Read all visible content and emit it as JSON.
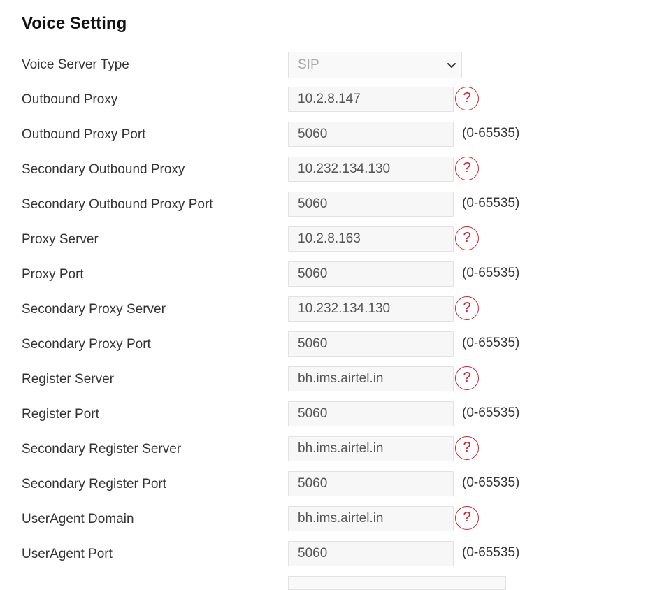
{
  "page": {
    "title": "Voice Setting"
  },
  "voice_server_type": {
    "label": "Voice Server Type",
    "value": "SIP"
  },
  "fields": [
    {
      "label": "Outbound Proxy",
      "value": "10.2.8.147",
      "suffix": "help"
    },
    {
      "label": "Outbound Proxy Port",
      "value": "5060",
      "suffix": "range",
      "range": "(0-65535)"
    },
    {
      "label": "Secondary Outbound Proxy",
      "value": "10.232.134.130",
      "suffix": "help"
    },
    {
      "label": "Secondary Outbound Proxy Port",
      "value": "5060",
      "suffix": "range",
      "range": "(0-65535)"
    },
    {
      "label": "Proxy Server",
      "value": "10.2.8.163",
      "suffix": "help"
    },
    {
      "label": "Proxy Port",
      "value": "5060",
      "suffix": "range",
      "range": "(0-65535)"
    },
    {
      "label": "Secondary Proxy Server",
      "value": "10.232.134.130",
      "suffix": "help"
    },
    {
      "label": "Secondary Proxy Port",
      "value": "5060",
      "suffix": "range",
      "range": "(0-65535)"
    },
    {
      "label": "Register Server",
      "value": "bh.ims.airtel.in",
      "suffix": "help"
    },
    {
      "label": "Register Port",
      "value": "5060",
      "suffix": "range",
      "range": "(0-65535)"
    },
    {
      "label": "Secondary Register Server",
      "value": "bh.ims.airtel.in",
      "suffix": "help"
    },
    {
      "label": "Secondary Register Port",
      "value": "5060",
      "suffix": "range",
      "range": "(0-65535)"
    },
    {
      "label": "UserAgent Domain",
      "value": "bh.ims.airtel.in",
      "suffix": "help"
    },
    {
      "label": "UserAgent Port",
      "value": "5060",
      "suffix": "range",
      "range": "(0-65535)"
    }
  ],
  "help_symbol": "?",
  "colors": {
    "accent": "#d5232d",
    "field_background": "#f7f7f7",
    "field_border": "#e2e2e2",
    "text": "#333333"
  },
  "icons": {
    "help": "question-circle-icon",
    "select": "chevron-down-icon"
  }
}
